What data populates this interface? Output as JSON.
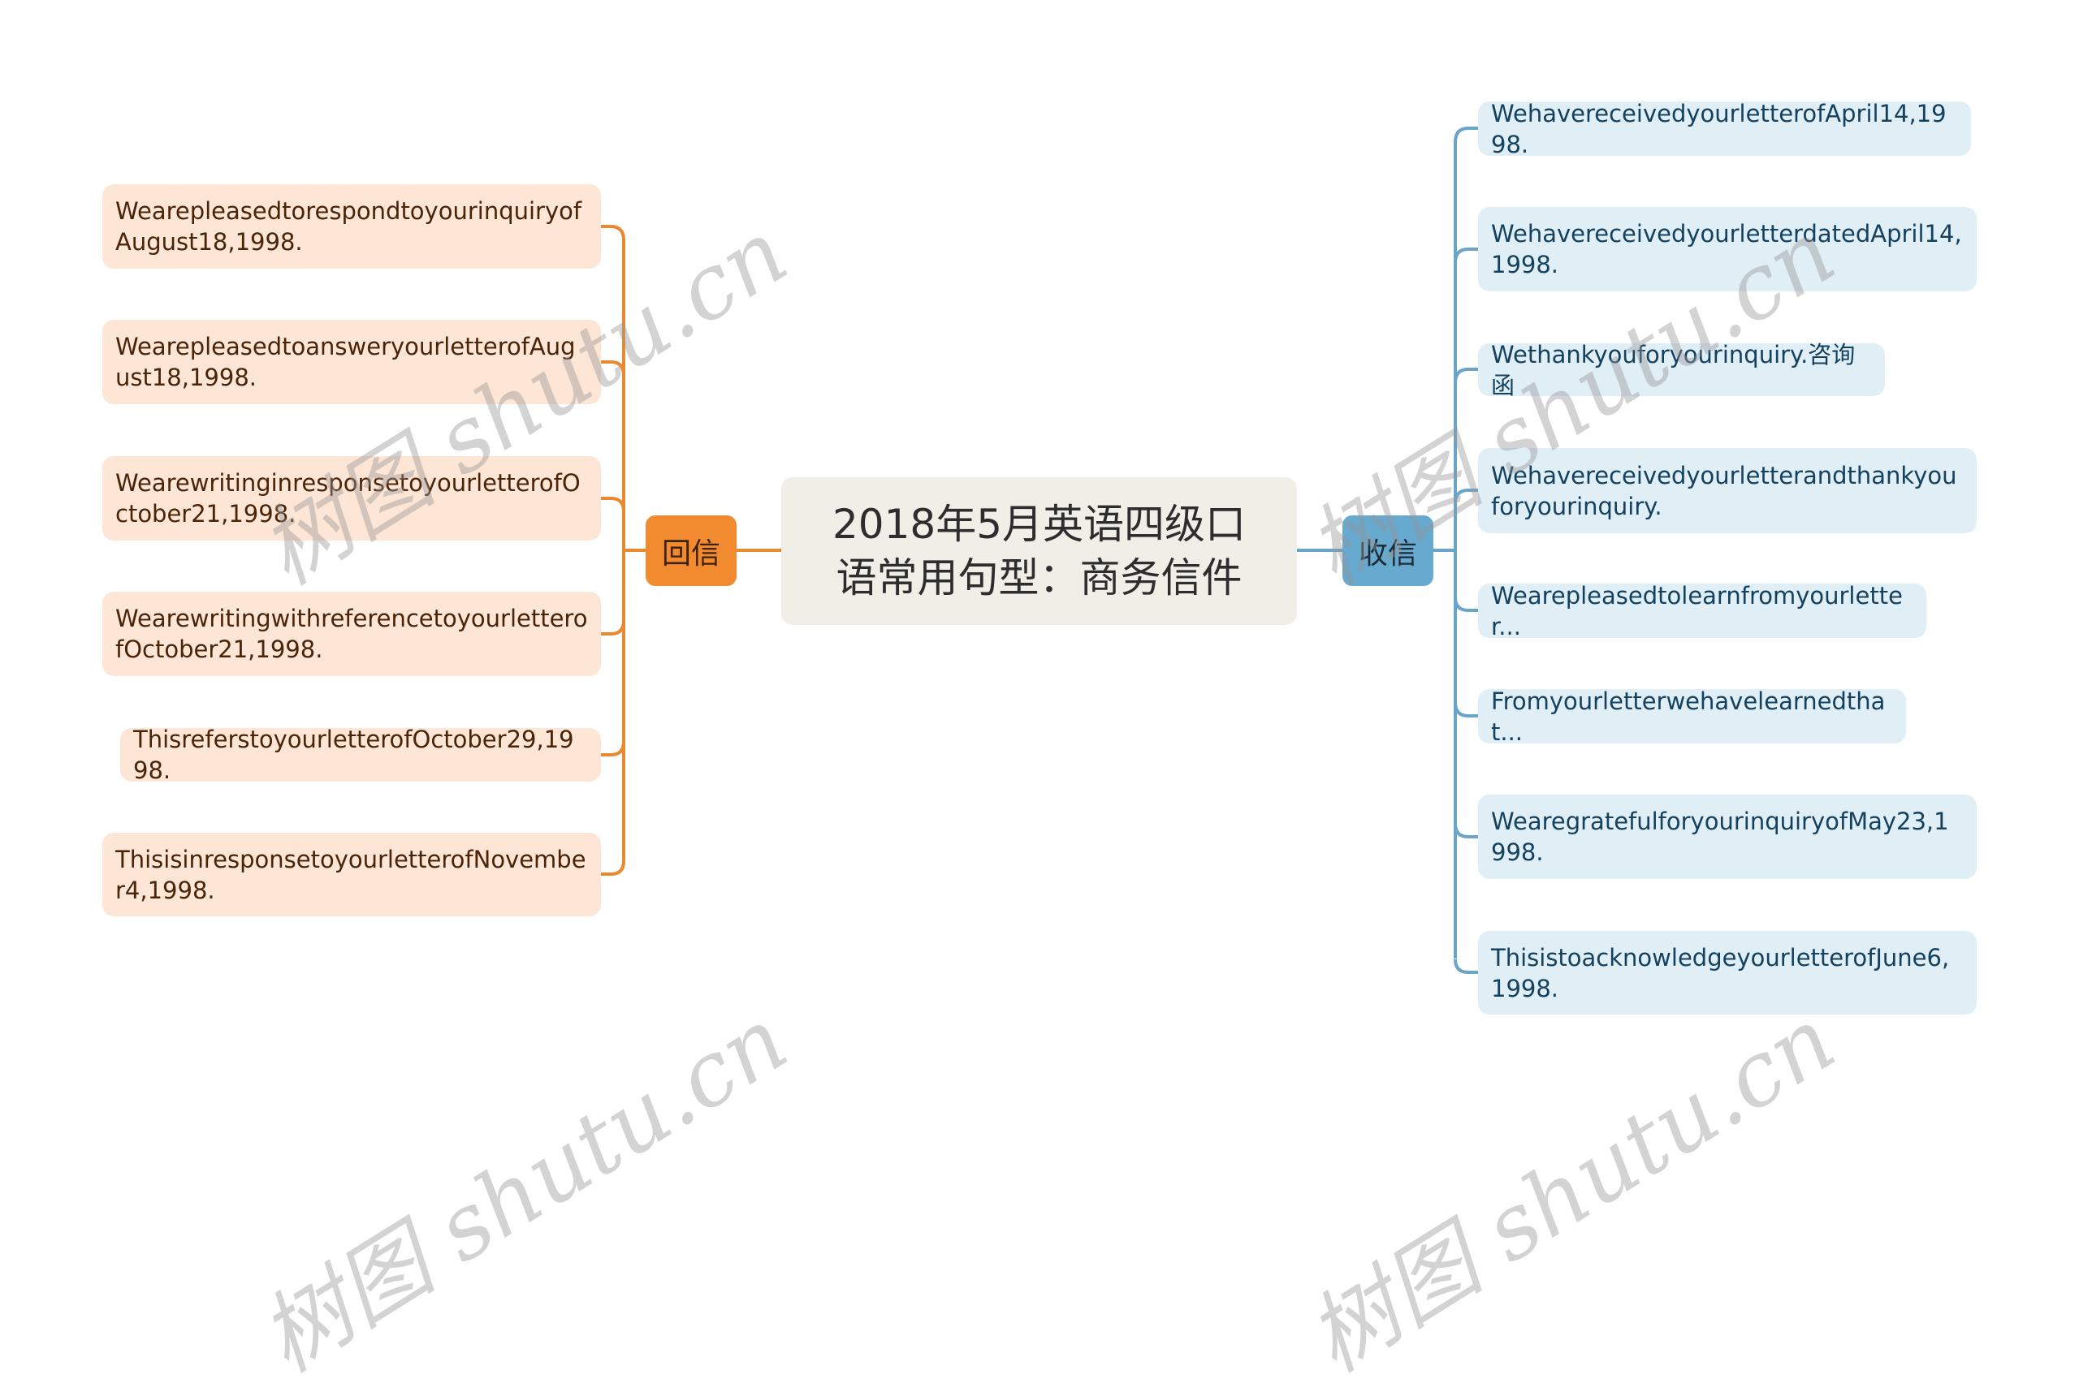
{
  "mindmap": {
    "root": "2018年5月英语四级口语常用句型：商务信件",
    "branches": {
      "left": {
        "label": "回信",
        "color": "#f28a2f",
        "leaves": [
          "WearepleasedtorespondtoyourinquiryofAugust18,1998.",
          "WearepleasedtoansweryourletterofAugust18,1998.",
          "WearewritinginresponsetoyourletterofOctober21,1998.",
          "WearewritingwithreferencetoyourletterofOctober21,1998.",
          "ThisreferstoyourletterofOctober29,1998.",
          "ThisisinresponsetoyourletterofNovember4,1998."
        ]
      },
      "right": {
        "label": "收信",
        "color": "#67a9cf",
        "leaves": [
          "WehavereceivedyourletterofApril14,1998.",
          "WehavereceivedyourletterdatedApril14,1998.",
          "Wethankyouforyourinquiry.咨询函",
          "Wehavereceivedyourletterandthankyouforyourinquiry.",
          "Wearepleasedtolearnfromyourletter...",
          "Fromyourletterwehavelearnedthat...",
          "WearegratefulforyourinquiryofMay23,1998.",
          "ThisistoacknowledgeyourletterofJune6,1998."
        ]
      }
    }
  },
  "watermark": "树图 shutu.cn"
}
